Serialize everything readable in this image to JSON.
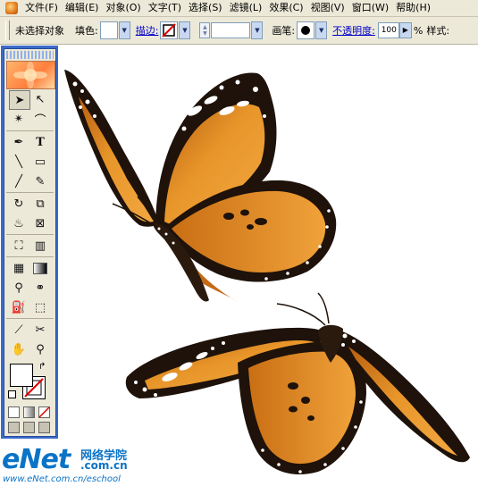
{
  "menubar": {
    "items": [
      "文件(F)",
      "编辑(E)",
      "对象(O)",
      "文字(T)",
      "选择(S)",
      "滤镜(L)",
      "效果(C)",
      "视图(V)",
      "窗口(W)",
      "帮助(H)"
    ]
  },
  "options_bar": {
    "selection_status": "未选择对象",
    "fill_label": "填色:",
    "stroke_label": "描边:",
    "brush_label": "画笔:",
    "opacity_label": "不透明度:",
    "opacity_value": "100",
    "percent": "%",
    "style_label": "样式:"
  },
  "toolbox": {
    "tools": [
      "selection-tool",
      "direct-selection-tool",
      "magic-wand-tool",
      "lasso-tool",
      "pen-tool",
      "type-tool",
      "line-tool",
      "rectangle-tool",
      "paintbrush-tool",
      "pencil-tool",
      "rotate-tool",
      "scale-tool",
      "warp-tool",
      "free-transform-tool",
      "symbol-sprayer-tool",
      "column-graph-tool",
      "mesh-tool",
      "gradient-tool",
      "eyedropper-tool",
      "blend-tool",
      "live-paint-bucket-tool",
      "live-paint-selection-tool",
      "slice-tool",
      "scissors-tool",
      "hand-tool",
      "zoom-tool"
    ]
  },
  "watermark": {
    "logo_e": "e",
    "logo_net": "Net",
    "chinese": "网络学院",
    "domain": ".com.cn",
    "url": "www.eNet.com.cn/eschool"
  },
  "colors": {
    "chrome": "#ece9d8",
    "toolbox_frame": "#3c6bc9",
    "butterfly_orange": "#e8962a",
    "butterfly_dark": "#1e120a",
    "watermark_blue": "#0b73c6"
  }
}
